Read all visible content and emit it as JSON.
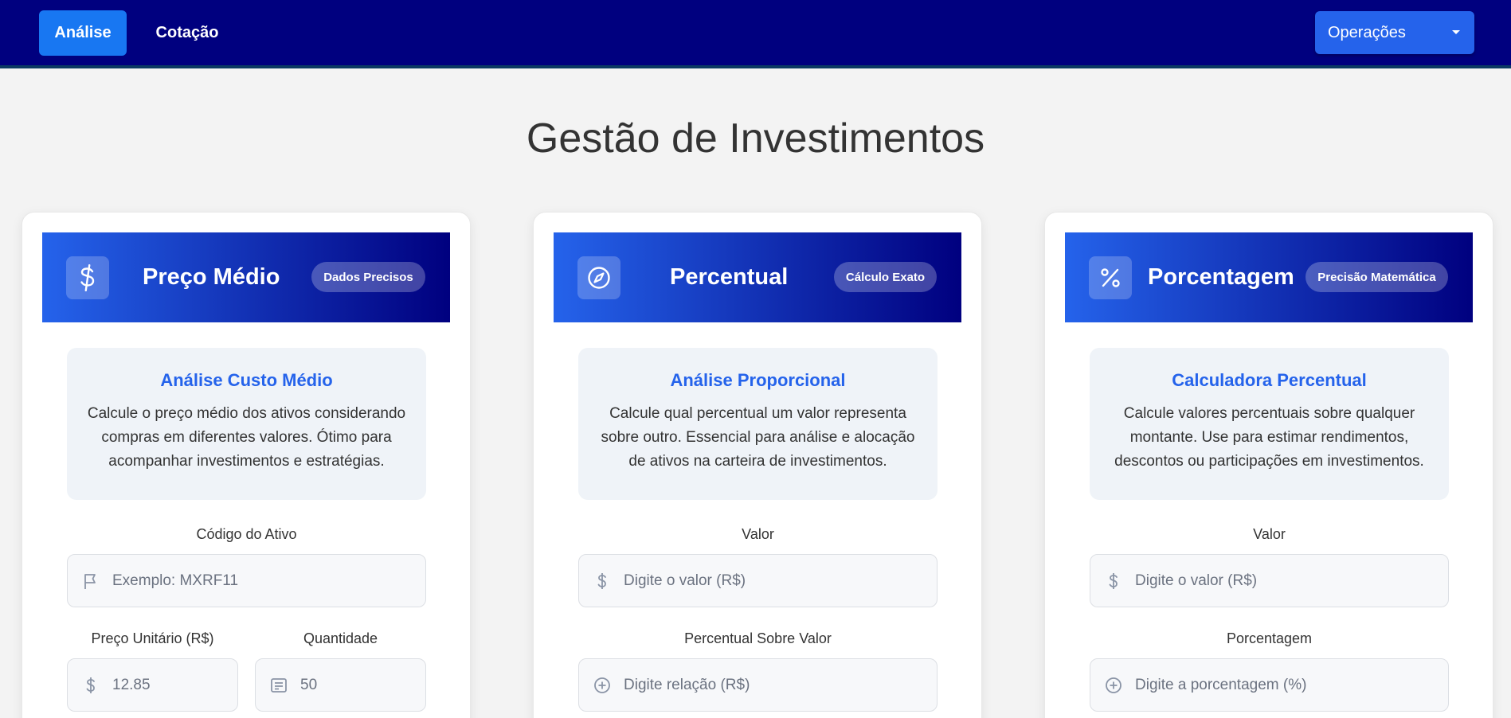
{
  "nav": {
    "tabs": [
      {
        "label": "Análise",
        "active": true
      },
      {
        "label": "Cotação",
        "active": false
      }
    ],
    "operations_label": "Operações"
  },
  "page": {
    "title": "Gestão de Investimentos"
  },
  "cards": [
    {
      "title": "Preço Médio",
      "badge": "Dados Precisos",
      "icon": "dollar-icon",
      "info_title": "Análise Custo Médio",
      "info_text": "Calcule o preço médio dos ativos considerando compras em diferentes valores. Ótimo para acompanhar investimentos e estratégias.",
      "fields": [
        {
          "label": "Código do Ativo",
          "placeholder": "Exemplo: MXRF11",
          "icon": "flag-icon"
        },
        {
          "label": "Preço Unitário (R$)",
          "value": "12.85",
          "icon": "dollar-icon"
        },
        {
          "label": "Quantidade",
          "value": "50",
          "icon": "list-box-icon"
        }
      ]
    },
    {
      "title": "Percentual",
      "badge": "Cálculo Exato",
      "icon": "compass-icon",
      "info_title": "Análise Proporcional",
      "info_text": "Calcule qual percentual um valor representa sobre outro. Essencial para análise e alocação de ativos na carteira de investimentos.",
      "fields": [
        {
          "label": "Valor",
          "placeholder": "Digite o valor (R$)",
          "icon": "dollar-icon"
        },
        {
          "label": "Percentual Sobre Valor",
          "placeholder": "Digite relação (R$)",
          "icon": "plus-circle-icon"
        }
      ]
    },
    {
      "title": "Porcentagem",
      "badge": "Precisão Matemática",
      "icon": "percent-icon",
      "info_title": "Calculadora Percentual",
      "info_text": "Calcule valores percentuais sobre qualquer montante. Use para estimar rendimentos, descontos ou participações em investimentos.",
      "fields": [
        {
          "label": "Valor",
          "placeholder": "Digite o valor (R$)",
          "icon": "dollar-icon"
        },
        {
          "label": "Porcentagem",
          "placeholder": "Digite a porcentagem (%)",
          "icon": "plus-circle-icon"
        }
      ]
    }
  ]
}
